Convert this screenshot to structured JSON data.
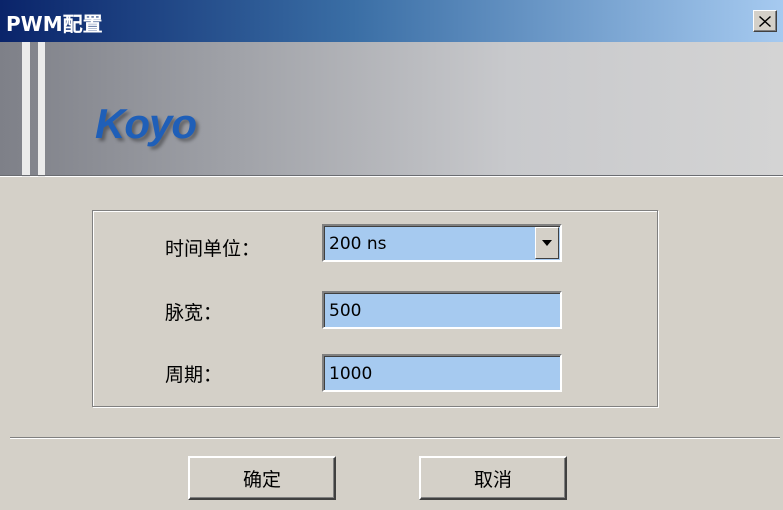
{
  "window": {
    "title": "PWM配置"
  },
  "banner": {
    "logo_text": "Koyo",
    "logo_color": "#1f5fb8"
  },
  "form": {
    "time_unit": {
      "label": "时间单位：",
      "value": "200 ns"
    },
    "pulse_width": {
      "label": "脉宽：",
      "value": "500"
    },
    "period": {
      "label": "周期：",
      "value": "1000"
    }
  },
  "buttons": {
    "ok": "确定",
    "cancel": "取消"
  },
  "colors": {
    "field_background": "#a6caf0",
    "dialog_background": "#d4d0c8",
    "titlebar_start": "#0a246a"
  },
  "icons": {
    "close": "close-icon",
    "dropdown": "chevron-down-icon"
  }
}
